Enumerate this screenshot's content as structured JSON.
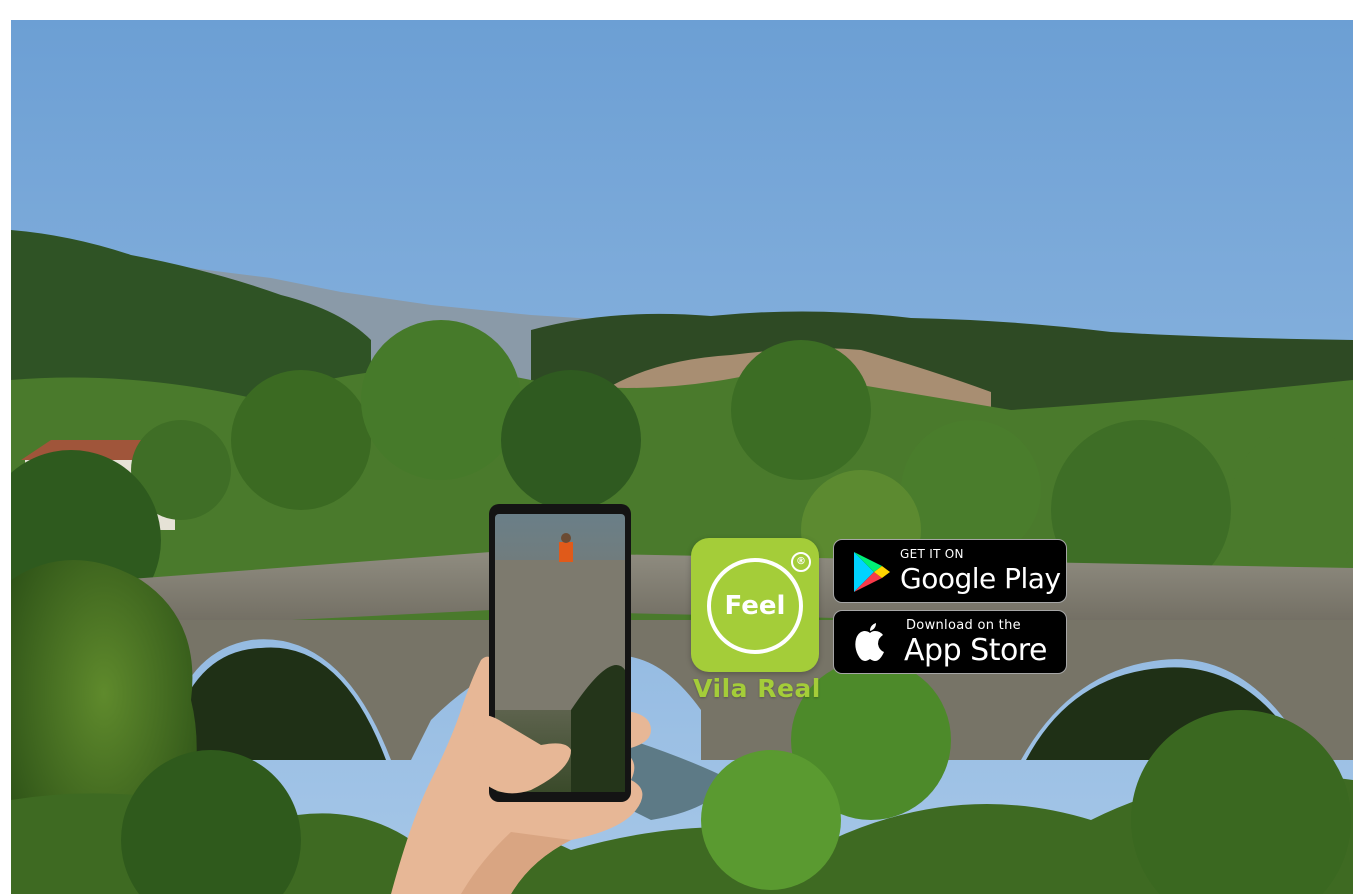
{
  "app": {
    "logo_word": "Feel",
    "registered_mark": "®",
    "city": "Vila Real",
    "brand_color": "#a4cd39"
  },
  "badges": {
    "google": {
      "small": "GET IT ON",
      "big": "Google Play",
      "icon": "google-play-icon"
    },
    "apple": {
      "small": "Download on the",
      "big": "App Store",
      "icon": "apple-icon"
    }
  },
  "photo": {
    "subject": "stone-arch-bridge",
    "icon": "phone-in-hand"
  }
}
